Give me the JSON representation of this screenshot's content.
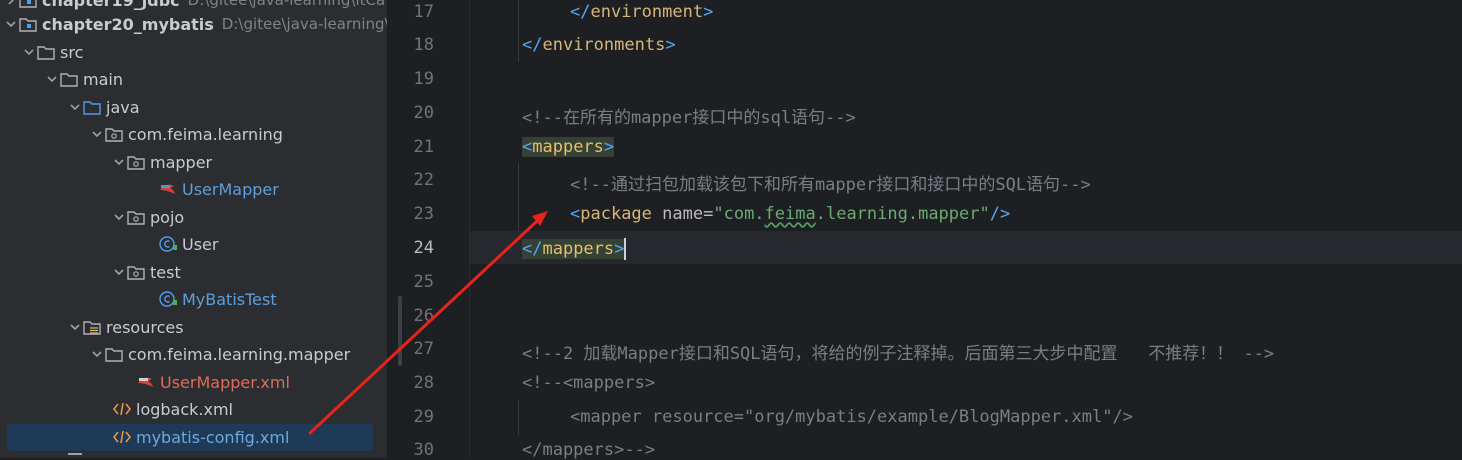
{
  "tree": {
    "rows": [
      {
        "label": "chapter19_jdbc",
        "hint": "D:\\gitee\\java-learning\\itCa"
      },
      {
        "label": "chapter20_mybatis",
        "hint": "D:\\gitee\\java-learning\\"
      },
      {
        "label": "src"
      },
      {
        "label": "main"
      },
      {
        "label": "java"
      },
      {
        "label": "com.feima.learning"
      },
      {
        "label": "mapper"
      },
      {
        "label": "UserMapper"
      },
      {
        "label": "pojo"
      },
      {
        "label": "User"
      },
      {
        "label": "test"
      },
      {
        "label": "MyBatisTest"
      },
      {
        "label": "resources"
      },
      {
        "label": "com.feima.learning.mapper"
      },
      {
        "label": "UserMapper.xml"
      },
      {
        "label": "logback.xml"
      },
      {
        "label": "mybatis-config.xml"
      }
    ]
  },
  "editor": {
    "line_numbers": [
      "17",
      "18",
      "19",
      "20",
      "21",
      "22",
      "23",
      "24",
      "25",
      "26",
      "27",
      "28",
      "29",
      "30"
    ],
    "current_line": "24",
    "lines": {
      "l17_close_env": "</environment>",
      "l18_close_envs": "</environments>",
      "l20_comment": "<!--在所有的mapper接口中的sql语句-->",
      "l21_mappers_open": "mappers",
      "l22_comment": "<!--通过扫包加载该包下和所有mapper接口和接口中的SQL语句-->",
      "l23_tag": "package",
      "l23_attr": "name",
      "l23_val_a": "\"com.",
      "l23_val_b": "feima",
      "l23_val_c": ".learning.mapper\"",
      "l24_mappers_close": "mappers",
      "l27_comment": "<!--2 加载Mapper接口和SQL语句，将给的例子注释掉。后面第三大步中配置   不推荐！！ -->",
      "l28_comment": "<!--<mappers>",
      "l29_comment": "<mapper resource=\"org/mybatis/example/BlogMapper.xml\"/>",
      "l30_comment": "</mappers>-->"
    }
  },
  "colors": {
    "tree_bg": "#2b2d30",
    "editor_bg": "#1e1f22",
    "selection": "#1e3a56",
    "annotation_arrow": "#e5241b"
  }
}
